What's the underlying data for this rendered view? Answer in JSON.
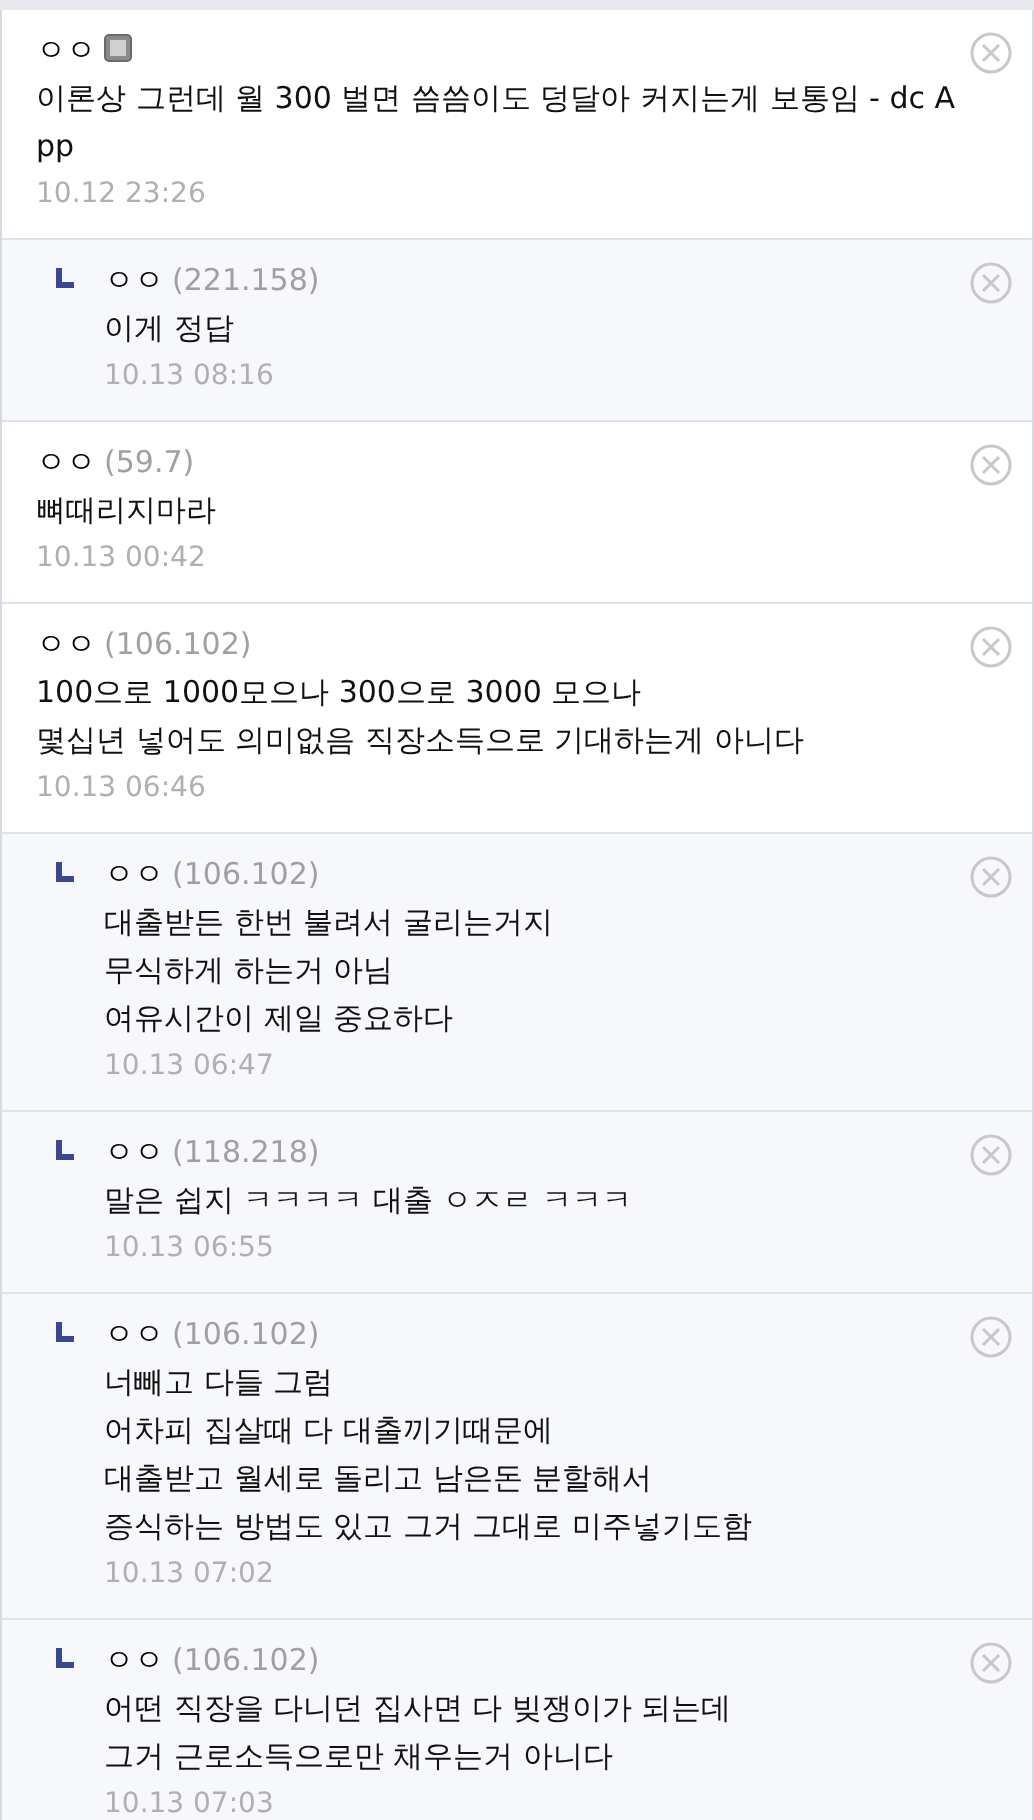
{
  "comments": [
    {
      "kind": "comment",
      "author": "ㅇㅇ",
      "mobile": true,
      "lines": [
        "이론상 그런데 월 300 벌면 씀씀이도 덩달아 커지는게 보통임 - dc App"
      ],
      "date": "10.12 23:26"
    },
    {
      "kind": "reply",
      "author": "ㅇㅇ",
      "ip": "(221.158)",
      "lines": [
        "이게 정답"
      ],
      "date": "10.13 08:16"
    },
    {
      "kind": "comment",
      "author": "ㅇㅇ",
      "ip": "(59.7)",
      "lines": [
        "뼈때리지마라"
      ],
      "date": "10.13 00:42"
    },
    {
      "kind": "comment",
      "author": "ㅇㅇ",
      "ip": "(106.102)",
      "lines": [
        "100으로 1000모으나 300으로 3000 모으나",
        "몇십년 넣어도 의미없음 직장소득으로 기대하는게 아니다"
      ],
      "date": "10.13 06:46"
    },
    {
      "kind": "reply",
      "author": "ㅇㅇ",
      "ip": "(106.102)",
      "lines": [
        "대출받든 한번 불려서 굴리는거지",
        "무식하게 하는거 아님",
        "여유시간이 제일 중요하다"
      ],
      "date": "10.13 06:47"
    },
    {
      "kind": "reply",
      "author": "ㅇㅇ",
      "ip": "(118.218)",
      "lines": [
        "말은 쉽지 ㅋㅋㅋㅋ 대출 ㅇㅈㄹ ㅋㅋㅋ"
      ],
      "date": "10.13 06:55"
    },
    {
      "kind": "reply",
      "author": "ㅇㅇ",
      "ip": "(106.102)",
      "lines": [
        "너빼고 다들 그럼",
        "어차피 집살때 다 대출끼기때문에",
        "대출받고 월세로 돌리고 남은돈 분할해서",
        "증식하는 방법도 있고 그거 그대로 미주넣기도함"
      ],
      "date": "10.13 07:02"
    },
    {
      "kind": "reply",
      "author": "ㅇㅇ",
      "ip": "(106.102)",
      "lines": [
        "어떤 직장을 다니던 집사면 다 빚쟁이가 되는데",
        "그거 근로소득으로만 채우는거 아니다"
      ],
      "date": "10.13 07:03"
    }
  ]
}
